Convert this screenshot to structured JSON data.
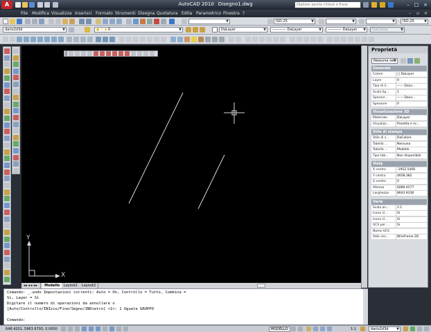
{
  "title": {
    "app": "AutoCAD 2010",
    "file": "Disegno1.dwg"
  },
  "search": {
    "placeholder": "Digitare parola chiave o frase"
  },
  "menu": [
    "File",
    "Modifica",
    "Visualizza",
    "Inserisci",
    "Formato",
    "Strumenti",
    "Disegna",
    "Quotatura",
    "Edita",
    "Parametrico",
    "Finestra",
    "?"
  ],
  "toolbars": {
    "workspace": "dario2d3d",
    "dimstyle": "ISO-25",
    "layer": "0",
    "color": "DaLayer",
    "linetype": "DaLayer",
    "lineweight": "DaLayer",
    "plotstyle": "DaColore"
  },
  "tabs": {
    "model": "Modello",
    "layout1": "Layout1",
    "layout2": "Layout2"
  },
  "ucs": {
    "x": "X",
    "y": "Y"
  },
  "props": {
    "title": "Proprietà",
    "selection": "Nessuna sel.",
    "sections": [
      {
        "name": "Generale",
        "rows": [
          {
            "k": "Colore",
            "v": "□ DaLayer"
          },
          {
            "k": "Layer",
            "v": "0"
          },
          {
            "k": "Tipo di li...",
            "v": "—— DaLa..."
          },
          {
            "k": "Scala tip...",
            "v": "1"
          },
          {
            "k": "Spessor...",
            "v": "—— DaLa..."
          },
          {
            "k": "Spessore",
            "v": "0"
          }
        ]
      },
      {
        "name": "Visualizzazione 3D",
        "rows": [
          {
            "k": "Materiale",
            "v": "DaLayer"
          },
          {
            "k": "Visualizz...",
            "v": "Proietta e ric..."
          }
        ]
      },
      {
        "name": "Stile di stampa",
        "rows": [
          {
            "k": "Stile di s...",
            "v": "DaColore"
          },
          {
            "k": "Tabella ...",
            "v": "Nessuna"
          },
          {
            "k": "Tabella ...",
            "v": "Modello"
          },
          {
            "k": "Tipo tab...",
            "v": "Non disponibile"
          }
        ]
      },
      {
        "name": "Vista",
        "rows": [
          {
            "k": "X centro",
            "v": "-1952.5408"
          },
          {
            "k": "Y centro",
            "v": "4658.382"
          },
          {
            "k": "Z centro",
            "v": "0"
          },
          {
            "k": "Altezza",
            "v": "6089.4577"
          },
          {
            "k": "Larghezza",
            "v": "8643.9336"
          }
        ]
      },
      {
        "name": "Varie",
        "rows": [
          {
            "k": "Scala an...",
            "v": "1:1"
          },
          {
            "k": "Icona U...",
            "v": "Sì"
          },
          {
            "k": "Icona U...",
            "v": "Sì"
          },
          {
            "k": "UCS per ...",
            "v": "Sì"
          },
          {
            "k": "Nome UCS",
            "v": ""
          },
          {
            "k": "Stile visi...",
            "v": "Wireframe 2D"
          }
        ]
      }
    ]
  },
  "command": {
    "lines": [
      "Comando: _.undo Impostazioni correnti: Auto = On, Controllo = Tutto, Combina =",
      "Sì, Layer = Sì",
      "Digitare il numero di operazioni da annullare o",
      "[Auto/Controllo/INIzio/Fine/Segno/INDietro] <1>: 1 Uguale GRUPPO"
    ],
    "prompt": "Comando:"
  },
  "status": {
    "coords": "648.4201, 5963.6793, 0.0000",
    "space": "MODELLO",
    "scale": "1:1",
    "workspace": "dario2d3d"
  },
  "colors": {
    "accent": "#c2262b",
    "canvas": "#000000"
  }
}
